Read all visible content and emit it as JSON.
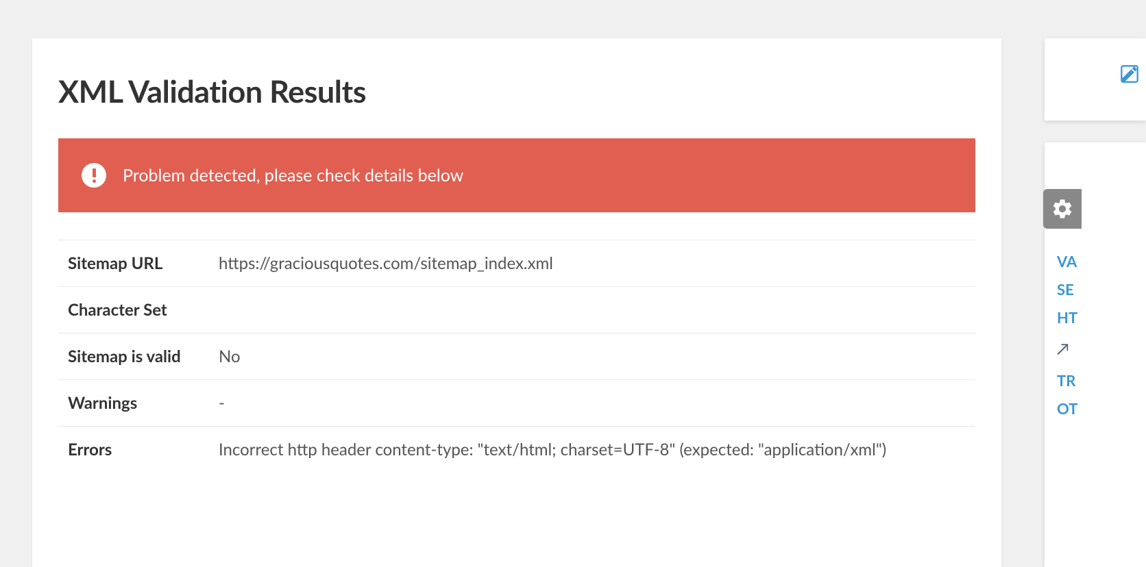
{
  "main": {
    "title": "XML Validation Results",
    "alert_text": "Problem detected, please check details below",
    "rows": [
      {
        "label": "Sitemap URL",
        "value": "https://graciousquotes.com/sitemap_index.xml"
      },
      {
        "label": "Character Set",
        "value": ""
      },
      {
        "label": "Sitemap is valid",
        "value": "No"
      },
      {
        "label": "Warnings",
        "value": "-"
      },
      {
        "label": "Errors",
        "value": "Incorrect http header content-type: \"text/html; charset=UTF-8\" (expected: \"application/xml\")"
      }
    ]
  },
  "sidebar": {
    "links": [
      {
        "text": "VA",
        "type": "primary"
      },
      {
        "text": "SE",
        "type": "primary"
      },
      {
        "text": "HT",
        "type": "primary"
      },
      {
        "text": "↗",
        "type": "alt"
      },
      {
        "text": "TR",
        "type": "primary"
      },
      {
        "text": "OT",
        "type": "primary"
      }
    ]
  }
}
